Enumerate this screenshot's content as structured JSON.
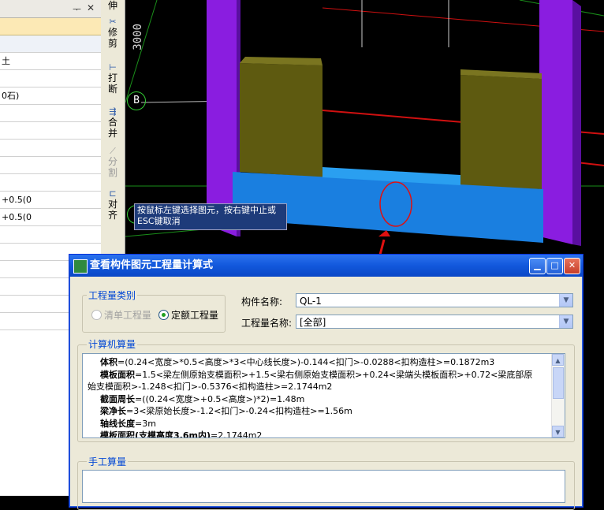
{
  "left_panel": {
    "pin_glyph": "ᅮ",
    "close_glyph": "✕",
    "rows": [
      "",
      "",
      "土",
      "",
      "0石)",
      "",
      "",
      "",
      "",
      "",
      "+0.5(0",
      "+0.5(0",
      "",
      "",
      "",
      "",
      "",
      ""
    ]
  },
  "toolbar": {
    "items": [
      {
        "label": "伸",
        "icon": ""
      },
      {
        "label": "修剪",
        "icon": "trim-icon"
      },
      {
        "label": "打断",
        "icon": "break-icon"
      },
      {
        "label": "合并",
        "icon": "merge-icon"
      },
      {
        "label": "分割",
        "icon": "split-icon"
      },
      {
        "label": "对齐",
        "icon": "align-icon"
      }
    ]
  },
  "viewport": {
    "dimension_label": "3000",
    "axis_label": "B",
    "tooltip": "按鼠标左键选择图元，按右键中止或ESC键取消"
  },
  "dialog": {
    "title": "查看构件图元工程量计算式",
    "quantity_type_legend": "工程量类别",
    "radio_bill": "清单工程量",
    "radio_quota": "定额工程量",
    "component_name_label": "构件名称:",
    "component_name_value": "QL-1",
    "quantity_name_label": "工程量名称:",
    "quantity_name_value": "[全部]",
    "computer_legend": "计算机算量",
    "manual_legend": "手工算量",
    "calc_lines": [
      {
        "key": "体积",
        "text": "=(0.24<宽度>*0.5<高度>*3<中心线长度>)-0.144<扣门>-0.0288<扣构造柱>=0.1872m3",
        "indent": true
      },
      {
        "key": "模板面积",
        "text": "=1.5<梁左侧原始支模面积>+1.5<梁右侧原始支模面积>+0.24<梁端头模板面积>+0.72<梁底部原",
        "indent": true
      },
      {
        "key": "",
        "text": "始支模面积>-1.248<扣门>-0.5376<扣构造柱>=2.1744m2",
        "indent": false
      },
      {
        "key": "截面周长",
        "text": "=((0.24<宽度>+0.5<高度>)*2)=1.48m",
        "indent": true
      },
      {
        "key": "梁净长",
        "text": "=3<梁原始长度>-1.2<扣门>-0.24<扣构造柱>=1.56m",
        "indent": true
      },
      {
        "key": "轴线长度",
        "text": "=3m",
        "indent": true
      },
      {
        "key": "模板面积(支模高度3.6m内)",
        "text": "=2.1744m2",
        "indent": true
      }
    ]
  },
  "colors": {
    "purple": "#8a1de0",
    "olive": "#5e5a10",
    "blue": "#1a7fe0",
    "red": "#e01010",
    "titlebar": "#1258dc"
  }
}
